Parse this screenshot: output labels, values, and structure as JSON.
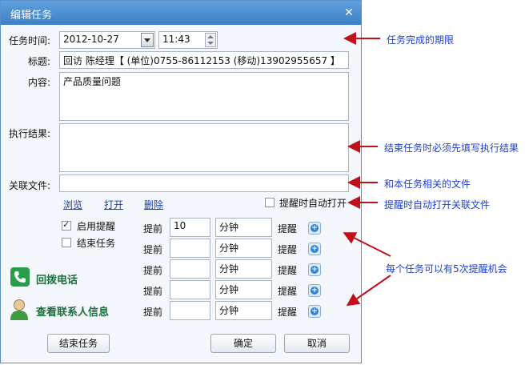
{
  "dialog": {
    "title": "编辑任务"
  },
  "task": {
    "time_label": "任务时间:",
    "date": "2012-10-27",
    "time": "11:43",
    "title_label": "标题:",
    "title_value": "回访 陈经理【 (单位)0755-86112153 (移动)13902955657 】",
    "content_label": "内容:",
    "content_value": "产品质量问题",
    "result_label": "执行结果:",
    "result_value": "",
    "file_label": "关联文件:",
    "file_value": ""
  },
  "file_links": {
    "browse": "浏览",
    "open": "打开",
    "delete": "删除"
  },
  "auto_open": {
    "label": "提醒时自动打开",
    "checked": false
  },
  "options": {
    "enable_reminder": {
      "label": "启用提醒",
      "checked": true
    },
    "end_task": {
      "label": "结束任务",
      "checked": false
    }
  },
  "reminders": [
    {
      "prefix": "提前",
      "value": "10",
      "unit": "分钟",
      "suffix": "提醒"
    },
    {
      "prefix": "提前",
      "value": "",
      "unit": "分钟",
      "suffix": "提醒"
    },
    {
      "prefix": "提前",
      "value": "",
      "unit": "分钟",
      "suffix": "提醒"
    },
    {
      "prefix": "提前",
      "value": "",
      "unit": "分钟",
      "suffix": "提醒"
    },
    {
      "prefix": "提前",
      "value": "",
      "unit": "分钟",
      "suffix": "提醒"
    }
  ],
  "side_actions": {
    "callback": "回拨电话",
    "contact": "查看联系人信息"
  },
  "buttons": {
    "end_task": "结束任务",
    "ok": "确定",
    "cancel": "取消"
  },
  "annotations": {
    "deadline": "任务完成的期限",
    "result_required": "结束任务时必须先填写执行结果",
    "related_file": "和本任务相关的文件",
    "auto_open_file": "提醒时自动打开关联文件",
    "five_reminders": "每个任务可以有5次提醒机会"
  },
  "colors": {
    "annotation_text": "#1f3fd0",
    "arrow": "#c0101a",
    "title_bar": "#4a8fd3"
  },
  "icons": {
    "phone": "phone-icon",
    "contact": "person-icon",
    "add": "plus-circle-icon"
  }
}
